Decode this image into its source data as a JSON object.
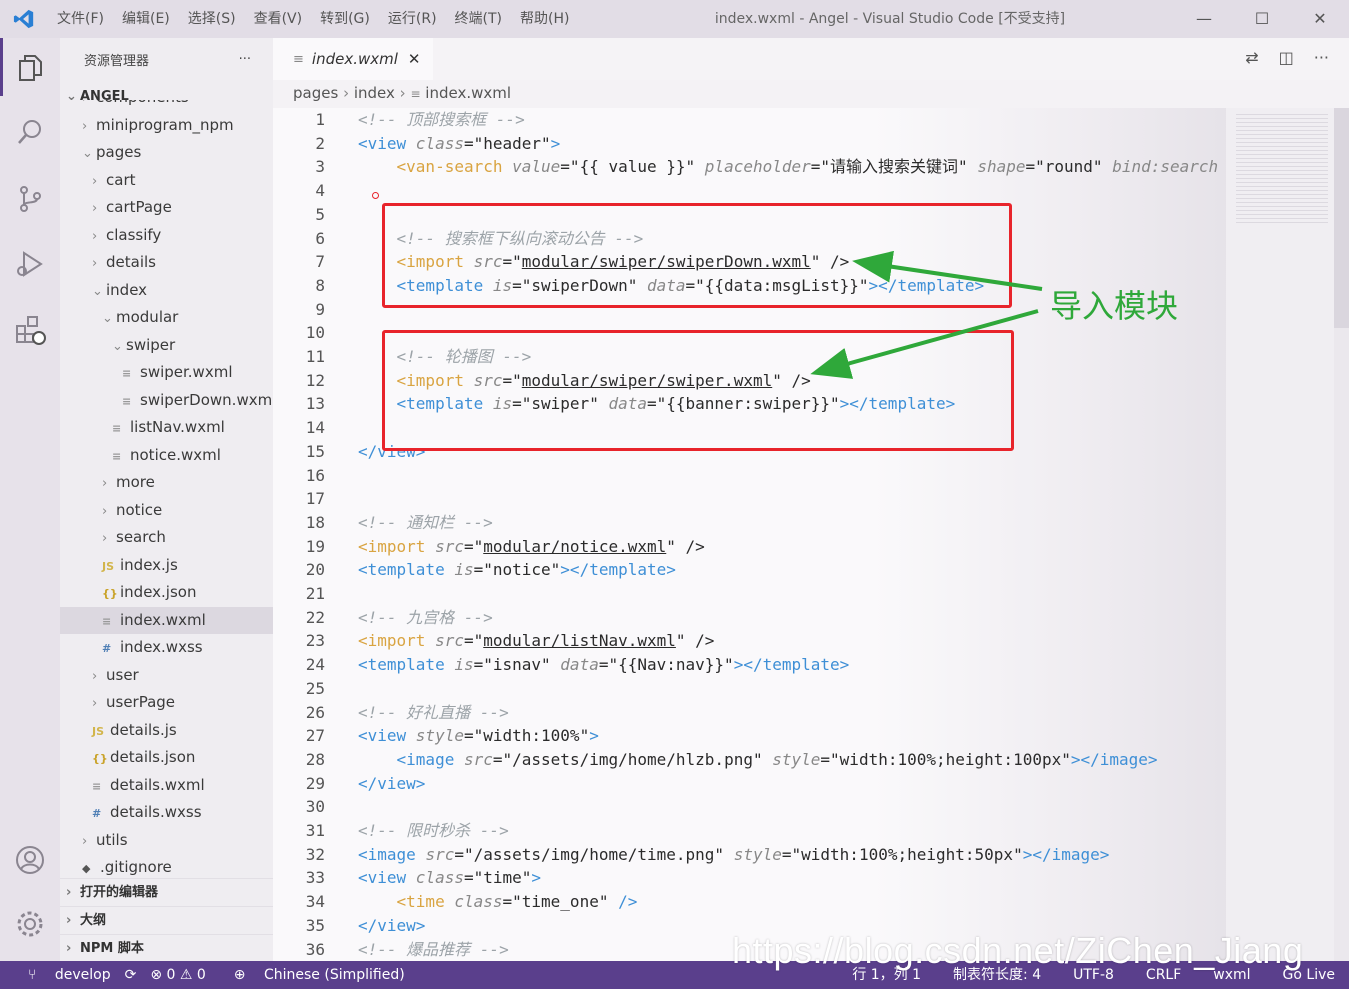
{
  "titlebar": {
    "menus": [
      "文件(F)",
      "编辑(E)",
      "选择(S)",
      "查看(V)",
      "转到(G)",
      "运行(R)",
      "终端(T)",
      "帮助(H)"
    ],
    "title": "index.wxml - Angel - Visual Studio Code [不受支持]",
    "minimize": "—",
    "maximize": "☐",
    "close": "✕"
  },
  "sidebar": {
    "header": "资源管理器",
    "more": "···",
    "project": "ANGEL",
    "sections": [
      "打开的编辑器",
      "大纲",
      "NPM 脚本"
    ],
    "items": [
      {
        "label": "components",
        "type": "folder"
      },
      {
        "label": "miniprogram_npm",
        "type": "folder"
      },
      {
        "label": "pages",
        "type": "folder-open"
      },
      {
        "label": "cart",
        "type": "folder"
      },
      {
        "label": "cartPage",
        "type": "folder"
      },
      {
        "label": "classify",
        "type": "folder"
      },
      {
        "label": "details",
        "type": "folder"
      },
      {
        "label": "index",
        "type": "folder-open"
      },
      {
        "label": "modular",
        "type": "folder-open"
      },
      {
        "label": "swiper",
        "type": "folder-open"
      },
      {
        "label": "swiper.wxml",
        "type": "wxml"
      },
      {
        "label": "swiperDown.wxml",
        "type": "wxml"
      },
      {
        "label": "listNav.wxml",
        "type": "wxml"
      },
      {
        "label": "notice.wxml",
        "type": "wxml"
      },
      {
        "label": "more",
        "type": "folder"
      },
      {
        "label": "notice",
        "type": "folder"
      },
      {
        "label": "search",
        "type": "folder"
      },
      {
        "label": "index.js",
        "type": "js"
      },
      {
        "label": "index.json",
        "type": "json"
      },
      {
        "label": "index.wxml",
        "type": "wxml"
      },
      {
        "label": "index.wxss",
        "type": "wxss"
      },
      {
        "label": "user",
        "type": "folder"
      },
      {
        "label": "userPage",
        "type": "folder"
      },
      {
        "label": "details.js",
        "type": "js"
      },
      {
        "label": "details.json",
        "type": "json"
      },
      {
        "label": "details.wxml",
        "type": "wxml"
      },
      {
        "label": "details.wxss",
        "type": "wxss"
      },
      {
        "label": "utils",
        "type": "folder"
      },
      {
        "label": ".gitignore",
        "type": "git"
      }
    ],
    "selected": "index.wxml"
  },
  "editor": {
    "tab": "index.wxml",
    "tab_close": "✕",
    "breadcrumb": [
      "pages",
      "index",
      "index.wxml"
    ],
    "annotation": "导入模块",
    "lines": [
      "1",
      "2",
      "3",
      "4",
      "5",
      "6",
      "7",
      "8",
      "9",
      "10",
      "11",
      "12",
      "13",
      "14",
      "15",
      "16",
      "17",
      "18",
      "19",
      "20",
      "21",
      "22",
      "23",
      "24",
      "25",
      "26",
      "27",
      "28",
      "29",
      "30",
      "31",
      "32",
      "33",
      "34",
      "35",
      "36"
    ],
    "code": {
      "l1": "<!-- 顶部搜索框 -->",
      "l2a": "<view ",
      "l2b": "class",
      "l2c": "=\"header\"",
      "l2d": ">",
      "l3a": "    <van-search ",
      "l3b": "value",
      "l3c": "=\"{{ value }}\" ",
      "l3d": "placeholder",
      "l3e": "=\"请输入搜索关键词\" ",
      "l3f": "shape",
      "l3g": "=\"round\" ",
      "l3h": "bind:search",
      "l6": "    <!-- 搜索框下纵向滚动公告 -->",
      "l7a": "    <import ",
      "l7b": "src",
      "l7c": "=\"",
      "l7d": "modular/swiper/swiperDown.wxml",
      "l7e": "\" />",
      "l8a": "    <template ",
      "l8b": "is",
      "l8c": "=\"swiperDown\" ",
      "l8d": "data",
      "l8e": "=\"{{data:msgList}}\"",
      "l8f": "></template>",
      "l11": "    <!-- 轮播图 -->",
      "l12a": "    <import ",
      "l12b": "src",
      "l12c": "=\"",
      "l12d": "modular/swiper/swiper.wxml",
      "l12e": "\" />",
      "l13a": "    <template ",
      "l13b": "is",
      "l13c": "=\"swiper\" ",
      "l13d": "data",
      "l13e": "=\"{{banner:swiper}}\"",
      "l13f": "></template>",
      "l15": "</view>",
      "l18": "<!-- 通知栏 -->",
      "l19a": "<import ",
      "l19b": "src",
      "l19c": "=\"",
      "l19d": "modular/notice.wxml",
      "l19e": "\" />",
      "l20a": "<template ",
      "l20b": "is",
      "l20c": "=\"notice\"",
      "l20d": "></template>",
      "l22": "<!-- 九宫格 -->",
      "l23a": "<import ",
      "l23b": "src",
      "l23c": "=\"",
      "l23d": "modular/listNav.wxml",
      "l23e": "\" />",
      "l24a": "<template ",
      "l24b": "is",
      "l24c": "=\"isnav\" ",
      "l24d": "data",
      "l24e": "=\"{{Nav:nav}}\"",
      "l24f": "></template>",
      "l26": "<!-- 好礼直播 -->",
      "l27a": "<view ",
      "l27b": "style",
      "l27c": "=\"width:100%\"",
      "l27d": ">",
      "l28a": "    <image ",
      "l28b": "src",
      "l28c": "=\"/assets/img/home/hlzb.png\" ",
      "l28d": "style",
      "l28e": "=\"width:100%;height:100px\"",
      "l28f": "></image>",
      "l29": "</view>",
      "l31": "<!-- 限时秒杀 -->",
      "l32a": "<image ",
      "l32b": "src",
      "l32c": "=\"/assets/img/home/time.png\" ",
      "l32d": "style",
      "l32e": "=\"width:100%;height:50px\"",
      "l32f": "></image>",
      "l33a": "<view ",
      "l33b": "class",
      "l33c": "=\"time\"",
      "l33d": ">",
      "l34a": "    <time ",
      "l34b": "class",
      "l34c": "=\"time_one\" ",
      "l34d": "/>",
      "l35": "</view>",
      "l36": "<!-- 爆品推荐 -->"
    }
  },
  "statusbar": {
    "branch": "develop",
    "sync": "⟳",
    "problems": "⊗ 0 ⚠ 0",
    "language": "Chinese (Simplified)",
    "position": "行 1，列 1",
    "tab_size": "制表符长度: 4",
    "encoding": "UTF-8",
    "eol": "CRLF",
    "mode": "wxml",
    "golive": "Go Live"
  },
  "watermark": "https://blog.csdn.net/ZiChen_Jiang"
}
